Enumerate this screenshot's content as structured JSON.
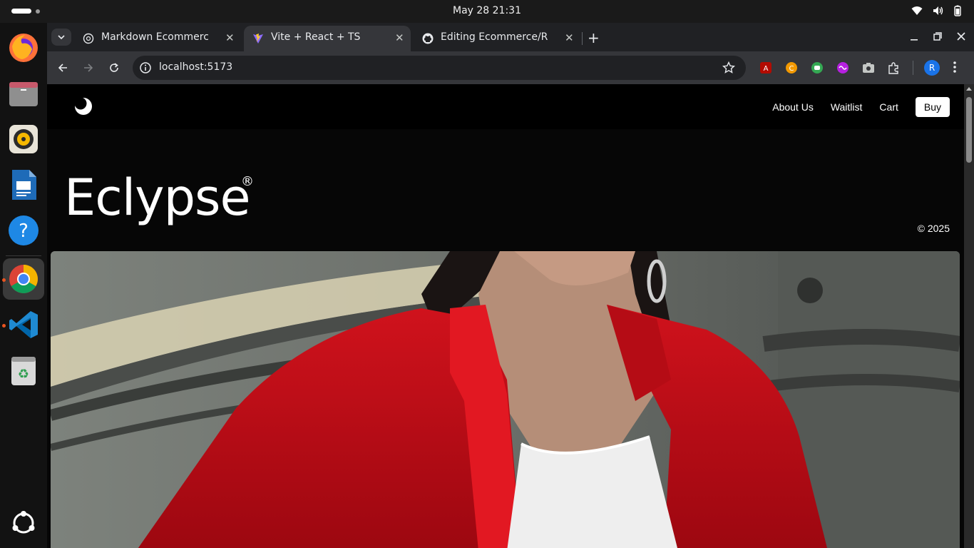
{
  "system": {
    "clock": "May 28  21:31"
  },
  "dock": {
    "items": [
      "firefox-icon",
      "files-icon",
      "rhythmbox-icon",
      "writer-icon",
      "help-icon",
      "chrome-icon",
      "vscode-icon",
      "trash-icon",
      "apps-grid-icon"
    ]
  },
  "browser": {
    "tabs": [
      {
        "label": "Markdown Ecommerce W",
        "active": false
      },
      {
        "label": "Vite + React + TS",
        "active": true
      },
      {
        "label": "Editing Ecommerce/REA",
        "active": false
      }
    ],
    "url": "localhost:5173",
    "profile_initial": "R"
  },
  "site": {
    "nav": {
      "about": "About Us",
      "waitlist": "Waitlist",
      "cart": "Cart",
      "buy": "Buy"
    },
    "hero": {
      "title": "Eclypse",
      "registered": "®",
      "copyright": "© 2025"
    }
  },
  "colors": {
    "page_bg": "#060606",
    "accent_red": "#c8101a",
    "chrome_bg": "#202124",
    "toolbar_bg": "#35363a"
  }
}
